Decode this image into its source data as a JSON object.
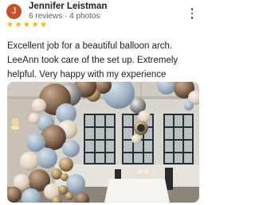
{
  "review": {
    "reviewer": {
      "initial": "J",
      "name": "Jennifer Leistman",
      "meta": "6 reviews · 4 photos",
      "avatar_color": "#c5512b"
    },
    "rating": {
      "value": 5,
      "max": 5,
      "star_color": "#f4b400"
    },
    "text": "Excellent job for a beautiful balloon arch. LeeAnn took care of the set up. Extremely helpful. Very happy with my experience",
    "photo": {
      "subject": "balloon arch photo"
    },
    "menu_icon": "more-vert-icon"
  }
}
